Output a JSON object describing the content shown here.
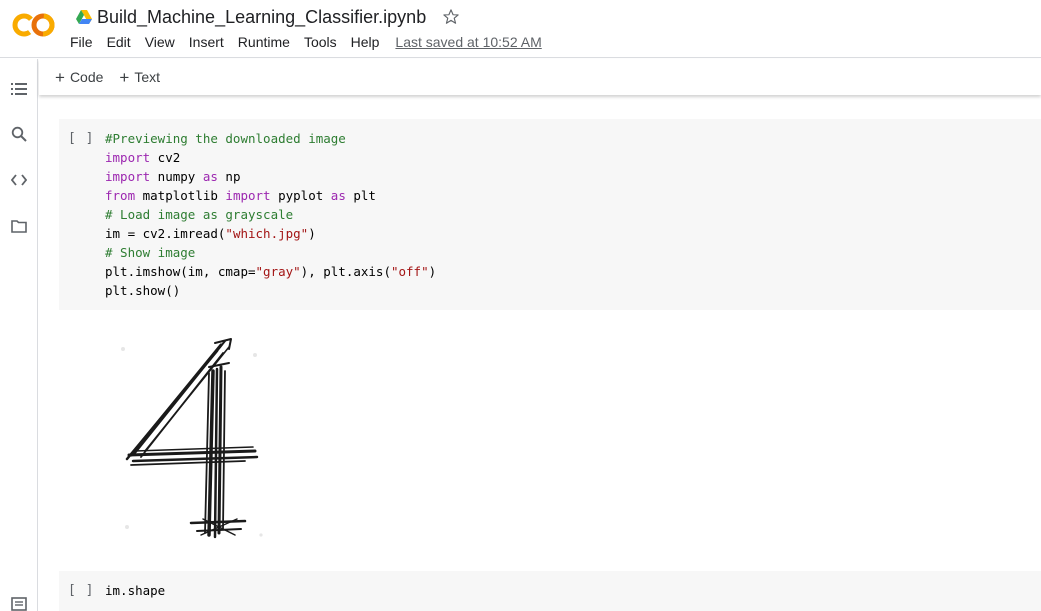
{
  "header": {
    "title": "Build_Machine_Learning_Classifier.ipynb",
    "menu": [
      "File",
      "Edit",
      "View",
      "Insert",
      "Runtime",
      "Tools",
      "Help"
    ],
    "last_saved": "Last saved at 10:52 AM"
  },
  "rail": {
    "icons": [
      "table-of-contents-icon",
      "search-icon",
      "code-snippets-icon",
      "files-icon",
      "terminal-icon"
    ]
  },
  "toolbar": {
    "add_code": "Code",
    "add_text": "Text",
    "plus": "+"
  },
  "cells": [
    {
      "run_label": "[ ]",
      "lines": [
        [
          {
            "t": "#Previewing the downloaded image",
            "c": "cm"
          }
        ],
        [
          {
            "t": "import",
            "c": "kw"
          },
          {
            "t": " cv2",
            "c": ""
          }
        ],
        [
          {
            "t": "import",
            "c": "kw"
          },
          {
            "t": " numpy ",
            "c": ""
          },
          {
            "t": "as",
            "c": "kw"
          },
          {
            "t": " np",
            "c": ""
          }
        ],
        [
          {
            "t": "from",
            "c": "kw"
          },
          {
            "t": " matplotlib ",
            "c": ""
          },
          {
            "t": "import",
            "c": "kw"
          },
          {
            "t": " pyplot ",
            "c": ""
          },
          {
            "t": "as",
            "c": "kw"
          },
          {
            "t": " plt",
            "c": ""
          }
        ],
        [
          {
            "t": "# Load image as grayscale",
            "c": "cm"
          }
        ],
        [
          {
            "t": "im = cv2.imread(",
            "c": ""
          },
          {
            "t": "\"which.jpg\"",
            "c": "st"
          },
          {
            "t": ")",
            "c": ""
          }
        ],
        [
          {
            "t": "# Show image",
            "c": "cm"
          }
        ],
        [
          {
            "t": "plt.imshow(im, cmap=",
            "c": ""
          },
          {
            "t": "\"gray\"",
            "c": "st"
          },
          {
            "t": "), plt.axis(",
            "c": ""
          },
          {
            "t": "\"off\"",
            "c": "st"
          },
          {
            "t": ")",
            "c": ""
          }
        ],
        [
          {
            "t": "plt.show()",
            "c": ""
          }
        ]
      ]
    },
    {
      "run_label": "[ ]",
      "lines": [
        [
          {
            "t": "im.shape",
            "c": ""
          }
        ]
      ]
    }
  ],
  "output": {
    "image": "handwritten-digit-4-image"
  },
  "colors": {
    "logo_orange": "#F9AB00",
    "logo_dark_orange": "#E8710A",
    "keyword": "#9c27b0",
    "comment": "#2e7d32",
    "string": "#a31515",
    "cell_bg": "#f7f7f7"
  }
}
